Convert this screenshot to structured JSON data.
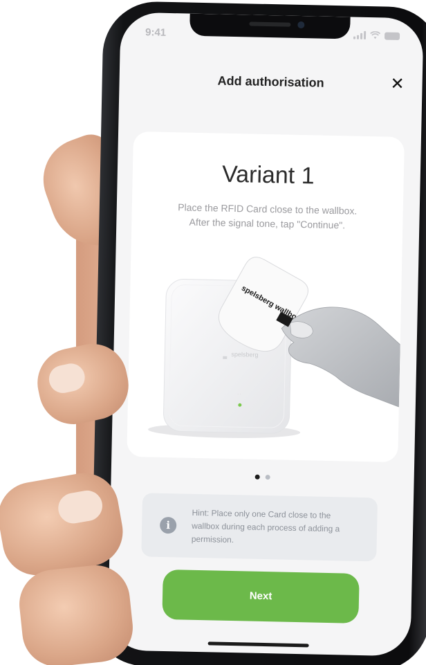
{
  "status_bar": {
    "time": "9:41",
    "signal_icon": "signal-icon",
    "wifi_icon": "wifi-icon",
    "battery_icon": "battery-icon"
  },
  "header": {
    "title": "Add authorisation",
    "close_icon": "close-icon"
  },
  "card": {
    "title": "Variant 1",
    "description_lines": [
      "Place the RFID Card close to the wallbox.",
      "After the signal tone, tap \"Continue\"."
    ],
    "rfid_card_text": "spelsberg wallbox",
    "wallbox_logo_text": "spelsberg"
  },
  "pagination": {
    "total": 2,
    "active_index": 0
  },
  "hint": {
    "icon": "info-icon",
    "lines": [
      "Hint: Place only one Card close to the",
      "wallbox during each process of adding a",
      "permission."
    ]
  },
  "actions": {
    "next_label": "Next"
  },
  "colors": {
    "accent_green": "#6cb94a",
    "screen_bg": "#f5f5f6",
    "hint_bg": "#e9ebee",
    "wallbox_led": "#7cc94e"
  }
}
